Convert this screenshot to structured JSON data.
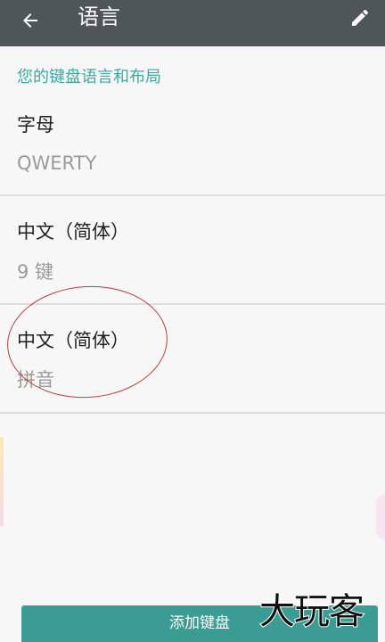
{
  "header": {
    "title": "语言"
  },
  "section": {
    "title": "您的键盘语言和布局"
  },
  "languages": [
    {
      "name": "字母",
      "layout": "QWERTY"
    },
    {
      "name": "中文（简体）",
      "layout": "9 键"
    },
    {
      "name": "中文（简体）",
      "layout": "拼音"
    }
  ],
  "footer": {
    "add_button_label": "添加键盘"
  },
  "watermark": "大玩客",
  "colors": {
    "app_bar": "#4f5659",
    "accent": "#42a6a1",
    "button": "#3a9c92",
    "annotation_circle": "#c23b3b"
  }
}
